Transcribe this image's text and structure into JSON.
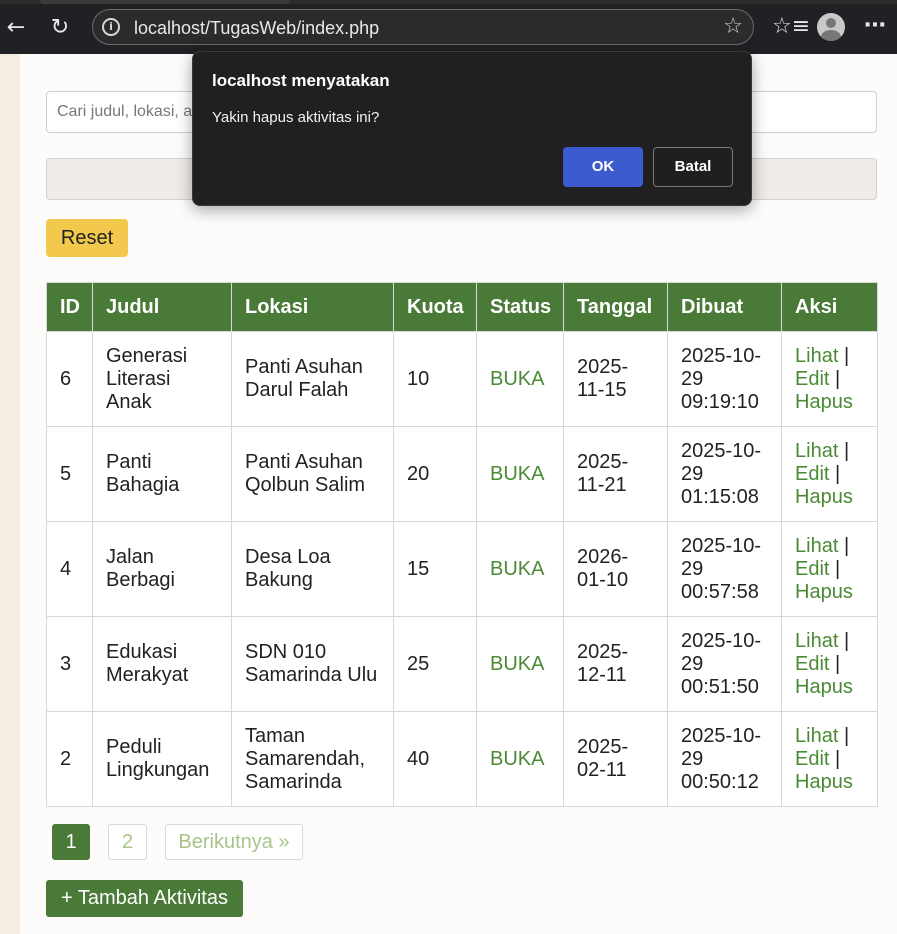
{
  "browser": {
    "url": "localhost/TugasWeb/index.php",
    "icons": [
      "back-icon",
      "reload-icon",
      "site-info-icon",
      "bookmark-star-icon",
      "favorites-icon",
      "profile-icon",
      "more-icon"
    ]
  },
  "search": {
    "placeholder": "Cari judul, lokasi, atau status...",
    "value": ""
  },
  "filter": {
    "value": ""
  },
  "reset_label": "Reset",
  "table": {
    "headers": [
      "ID",
      "Judul",
      "Lokasi",
      "Kuota",
      "Status",
      "Tanggal",
      "Dibuat",
      "Aksi"
    ],
    "rows": [
      {
        "id": "6",
        "judul": "Generasi Literasi Anak",
        "lokasi": "Panti Asuhan Darul Falah",
        "kuota": "10",
        "status": "BUKA",
        "tanggal": "2025-11-15",
        "dibuat": "2025-10-29 09:19:10"
      },
      {
        "id": "5",
        "judul": "Panti Bahagia",
        "lokasi": "Panti Asuhan Qolbun Salim",
        "kuota": "20",
        "status": "BUKA",
        "tanggal": "2025-11-21",
        "dibuat": "2025-10-29 01:15:08"
      },
      {
        "id": "4",
        "judul": "Jalan Berbagi",
        "lokasi": "Desa Loa Bakung",
        "kuota": "15",
        "status": "BUKA",
        "tanggal": "2026-01-10",
        "dibuat": "2025-10-29 00:57:58"
      },
      {
        "id": "3",
        "judul": "Edukasi Merakyat",
        "lokasi": "SDN 010 Samarinda Ulu",
        "kuota": "25",
        "status": "BUKA",
        "tanggal": "2025-12-11",
        "dibuat": "2025-10-29 00:51:50"
      },
      {
        "id": "2",
        "judul": "Peduli Lingkungan",
        "lokasi": "Taman Samarendah, Samarinda",
        "kuota": "40",
        "status": "BUKA",
        "tanggal": "2025-02-11",
        "dibuat": "2025-10-29 00:50:12"
      }
    ],
    "actions": {
      "view": "Lihat",
      "edit": "Edit",
      "delete": "Hapus",
      "separator": "|"
    }
  },
  "pagination": {
    "page1": "1",
    "page2": "2",
    "next": "Berikutnya »"
  },
  "add_label": "+ Tambah Aktivitas",
  "dialog": {
    "title": "localhost menyatakan",
    "message": "Yakin hapus aktivitas ini?",
    "ok": "OK",
    "cancel": "Batal"
  },
  "colors": {
    "header_green": "#4a7a37",
    "status_green": "#4a8a35",
    "reset_yellow": "#f2c94c",
    "dialog_ok_blue": "#3b5bcf"
  }
}
